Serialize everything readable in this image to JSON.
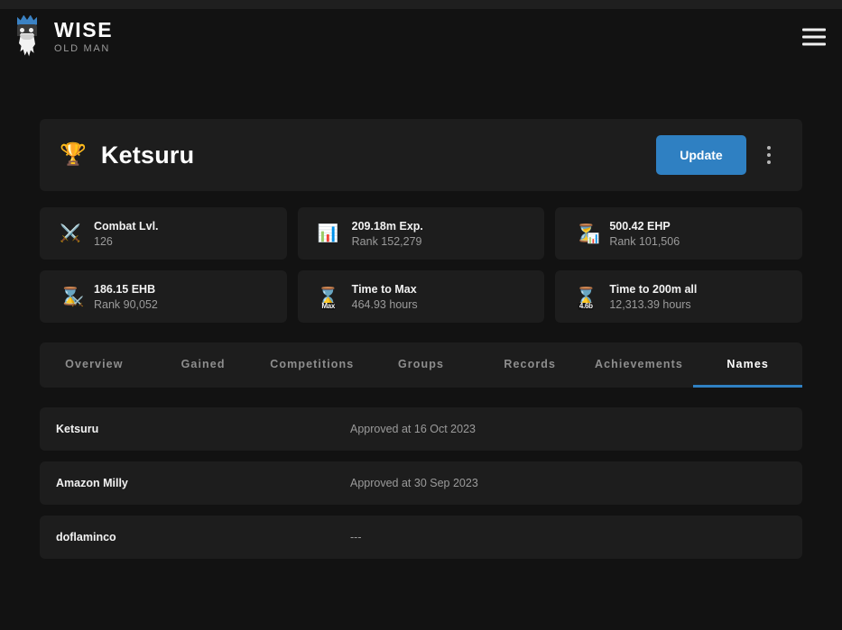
{
  "header": {
    "brand_title": "WISE",
    "brand_subtitle": "OLD MAN",
    "logo_icon": "wizard-old-man-logo",
    "menu_icon": "hamburger-menu-icon"
  },
  "player": {
    "trophy_icon": "🏆",
    "name": "Ketsuru",
    "update_label": "Update",
    "more_icon": "kebab-menu-icon",
    "accent_color": "#2f80c2"
  },
  "stats": [
    {
      "icon": "⚔️",
      "icon_name": "crossed-swords-icon",
      "badge": "",
      "mini": "",
      "label": "Combat Lvl.",
      "value": "126"
    },
    {
      "icon": "📊",
      "icon_name": "bar-chart-icon",
      "badge": "",
      "mini": "",
      "label": "209.18m Exp.",
      "value": "Rank 152,279"
    },
    {
      "icon": "⏳",
      "icon_name": "hourglass-chart-icon",
      "badge": "",
      "mini": "📊",
      "label": "500.42 EHP",
      "value": "Rank 101,506"
    },
    {
      "icon": "⌛",
      "icon_name": "hourglass-swords-icon",
      "badge": "",
      "mini": "⚔️",
      "label": "186.15 EHB",
      "value": "Rank 90,052"
    },
    {
      "icon": "⌛",
      "icon_name": "hourglass-max-icon",
      "badge": "Max",
      "mini": "",
      "label": "Time to Max",
      "value": "464.93 hours"
    },
    {
      "icon": "⌛",
      "icon_name": "hourglass-200m-icon",
      "badge": "4.6b",
      "mini": "",
      "label": "Time to 200m all",
      "value": "12,313.39 hours"
    }
  ],
  "tabs": [
    {
      "label": "Overview",
      "active": false
    },
    {
      "label": "Gained",
      "active": false
    },
    {
      "label": "Competitions",
      "active": false
    },
    {
      "label": "Groups",
      "active": false
    },
    {
      "label": "Records",
      "active": false
    },
    {
      "label": "Achievements",
      "active": false
    },
    {
      "label": "Names",
      "active": true
    }
  ],
  "names": [
    {
      "name": "Ketsuru",
      "date": "Approved at 16 Oct 2023"
    },
    {
      "name": "Amazon Milly",
      "date": "Approved at 30 Sep 2023"
    },
    {
      "name": "doflaminco",
      "date": "---"
    }
  ]
}
